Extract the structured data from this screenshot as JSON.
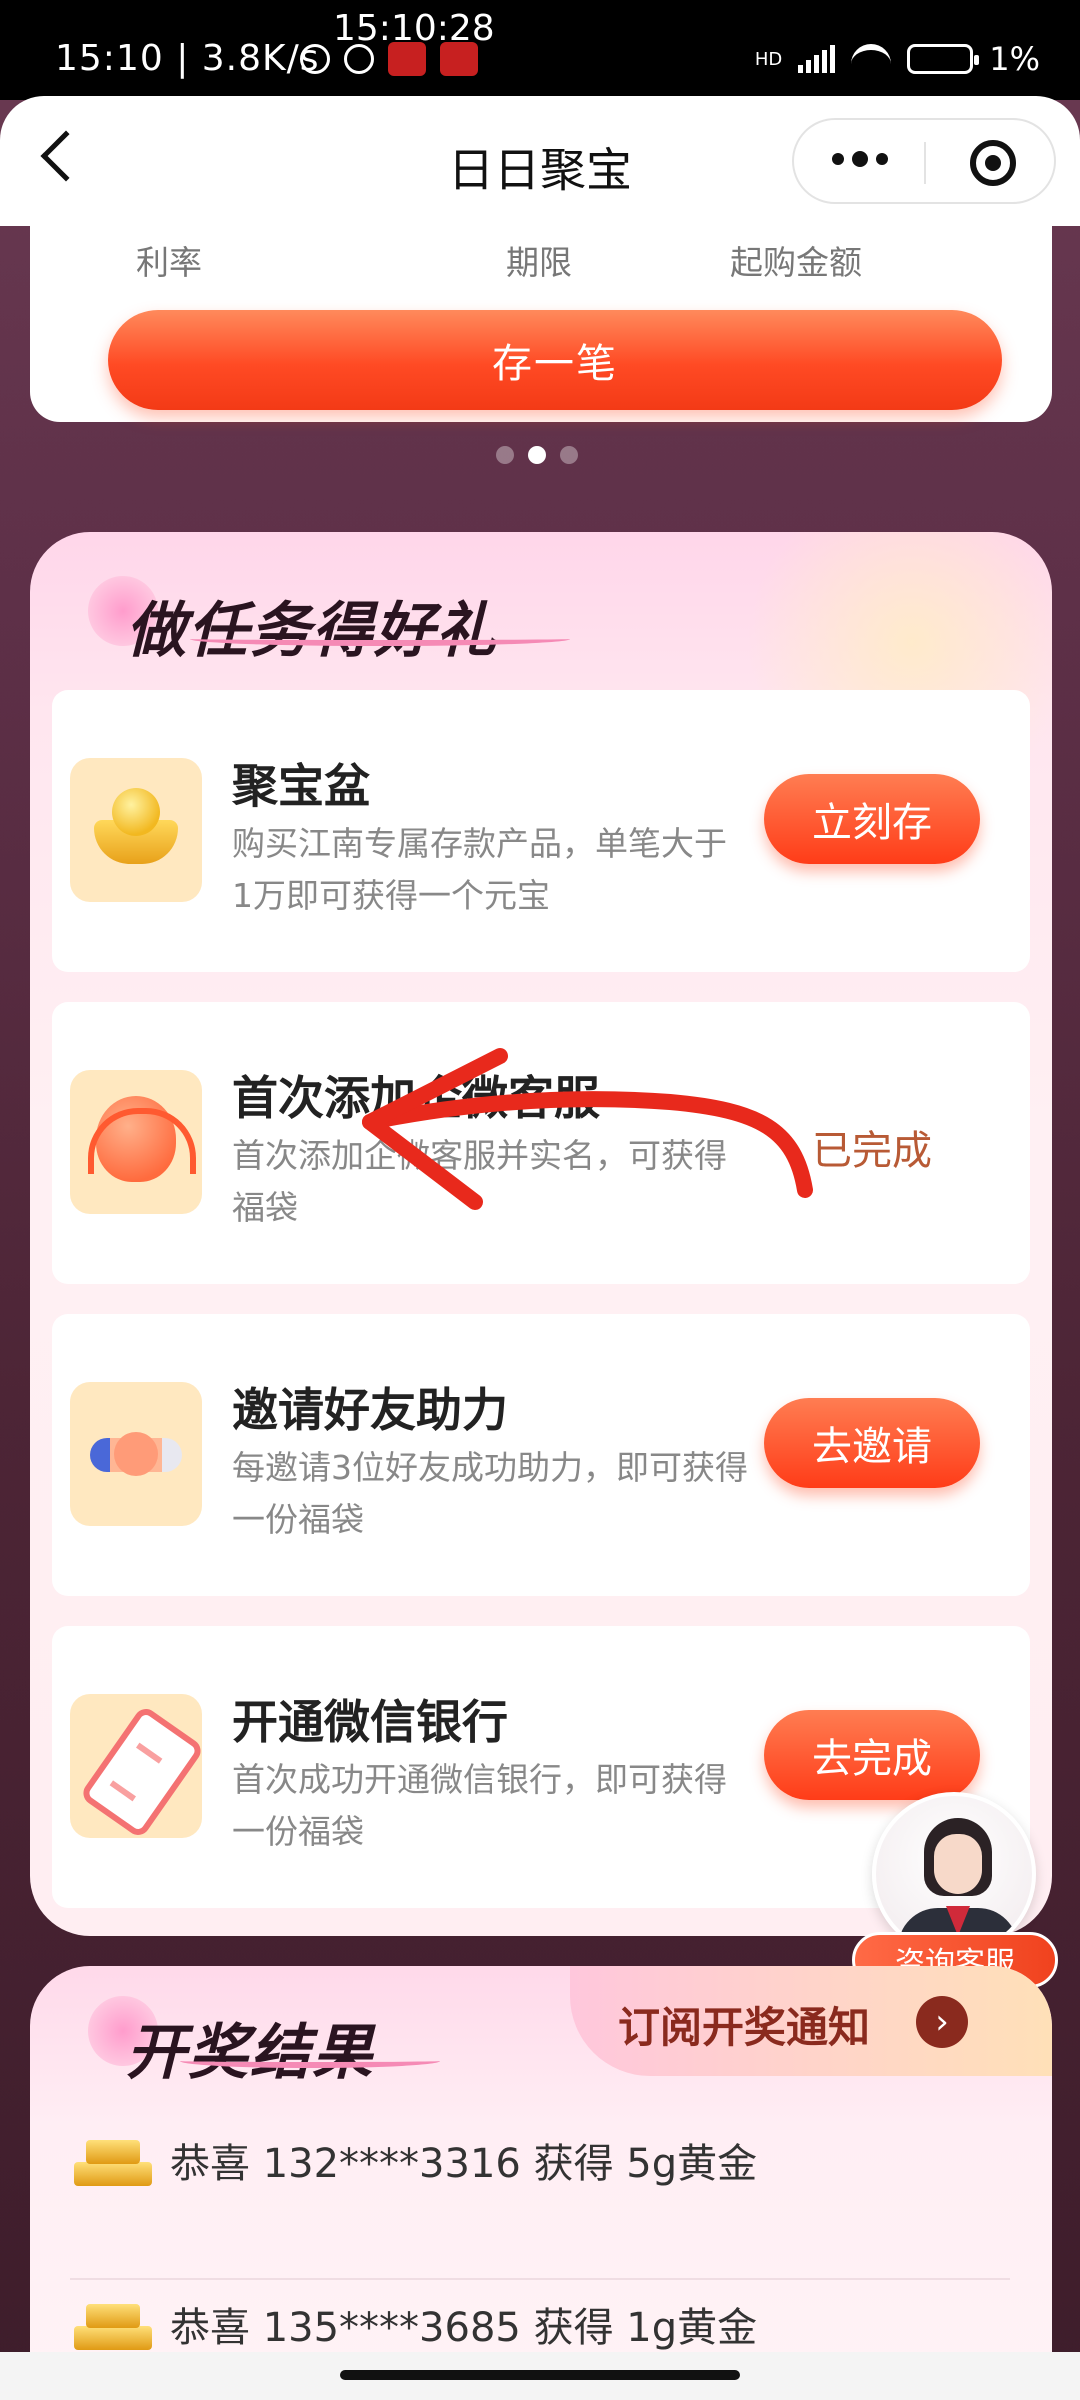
{
  "status_bar": {
    "left_text": "15:10 | 3.8K/s",
    "clock_overlay": "15:10:28",
    "battery": "1%",
    "network": "HD"
  },
  "nav": {
    "title": "日日聚宝"
  },
  "product": {
    "labels": [
      "利率",
      "期限",
      "起购金额"
    ],
    "button_label": "存一笔"
  },
  "carousel": {
    "active_index": 1,
    "count": 3
  },
  "tasks": {
    "section_title": "做任务得好礼",
    "items": [
      {
        "icon": "gold-ingot-icon",
        "title": "聚宝盆",
        "desc": "购买江南专属存款产品，单笔大于1万即可获得一个元宝",
        "action": "立刻存",
        "done": false
      },
      {
        "icon": "customer-service-icon",
        "title": "首次添加企微客服",
        "desc": "首次添加企微客服并实名，可获得福袋",
        "action": "已完成",
        "done": true
      },
      {
        "icon": "handshake-icon",
        "title": "邀请好友助力",
        "desc": "每邀请3位好友成功助力，即可获得一份福袋",
        "action": "去邀请",
        "done": false
      },
      {
        "icon": "phone-card-icon",
        "title": "开通微信银行",
        "desc": "首次成功开通微信银行，即可获得一份福袋",
        "action": "去完成",
        "done": false
      }
    ]
  },
  "customer_service": {
    "label": "咨询客服"
  },
  "results": {
    "section_title": "开奖结果",
    "subscribe_label": "订阅开奖通知",
    "rows": [
      {
        "text": "恭喜 132****3316 获得 5g黄金"
      },
      {
        "text": "恭喜 135****3685 获得 1g黄金"
      }
    ]
  },
  "colors": {
    "accent": "#ff4a24",
    "done_text": "#b85a35",
    "annotation": "#e8291c"
  }
}
